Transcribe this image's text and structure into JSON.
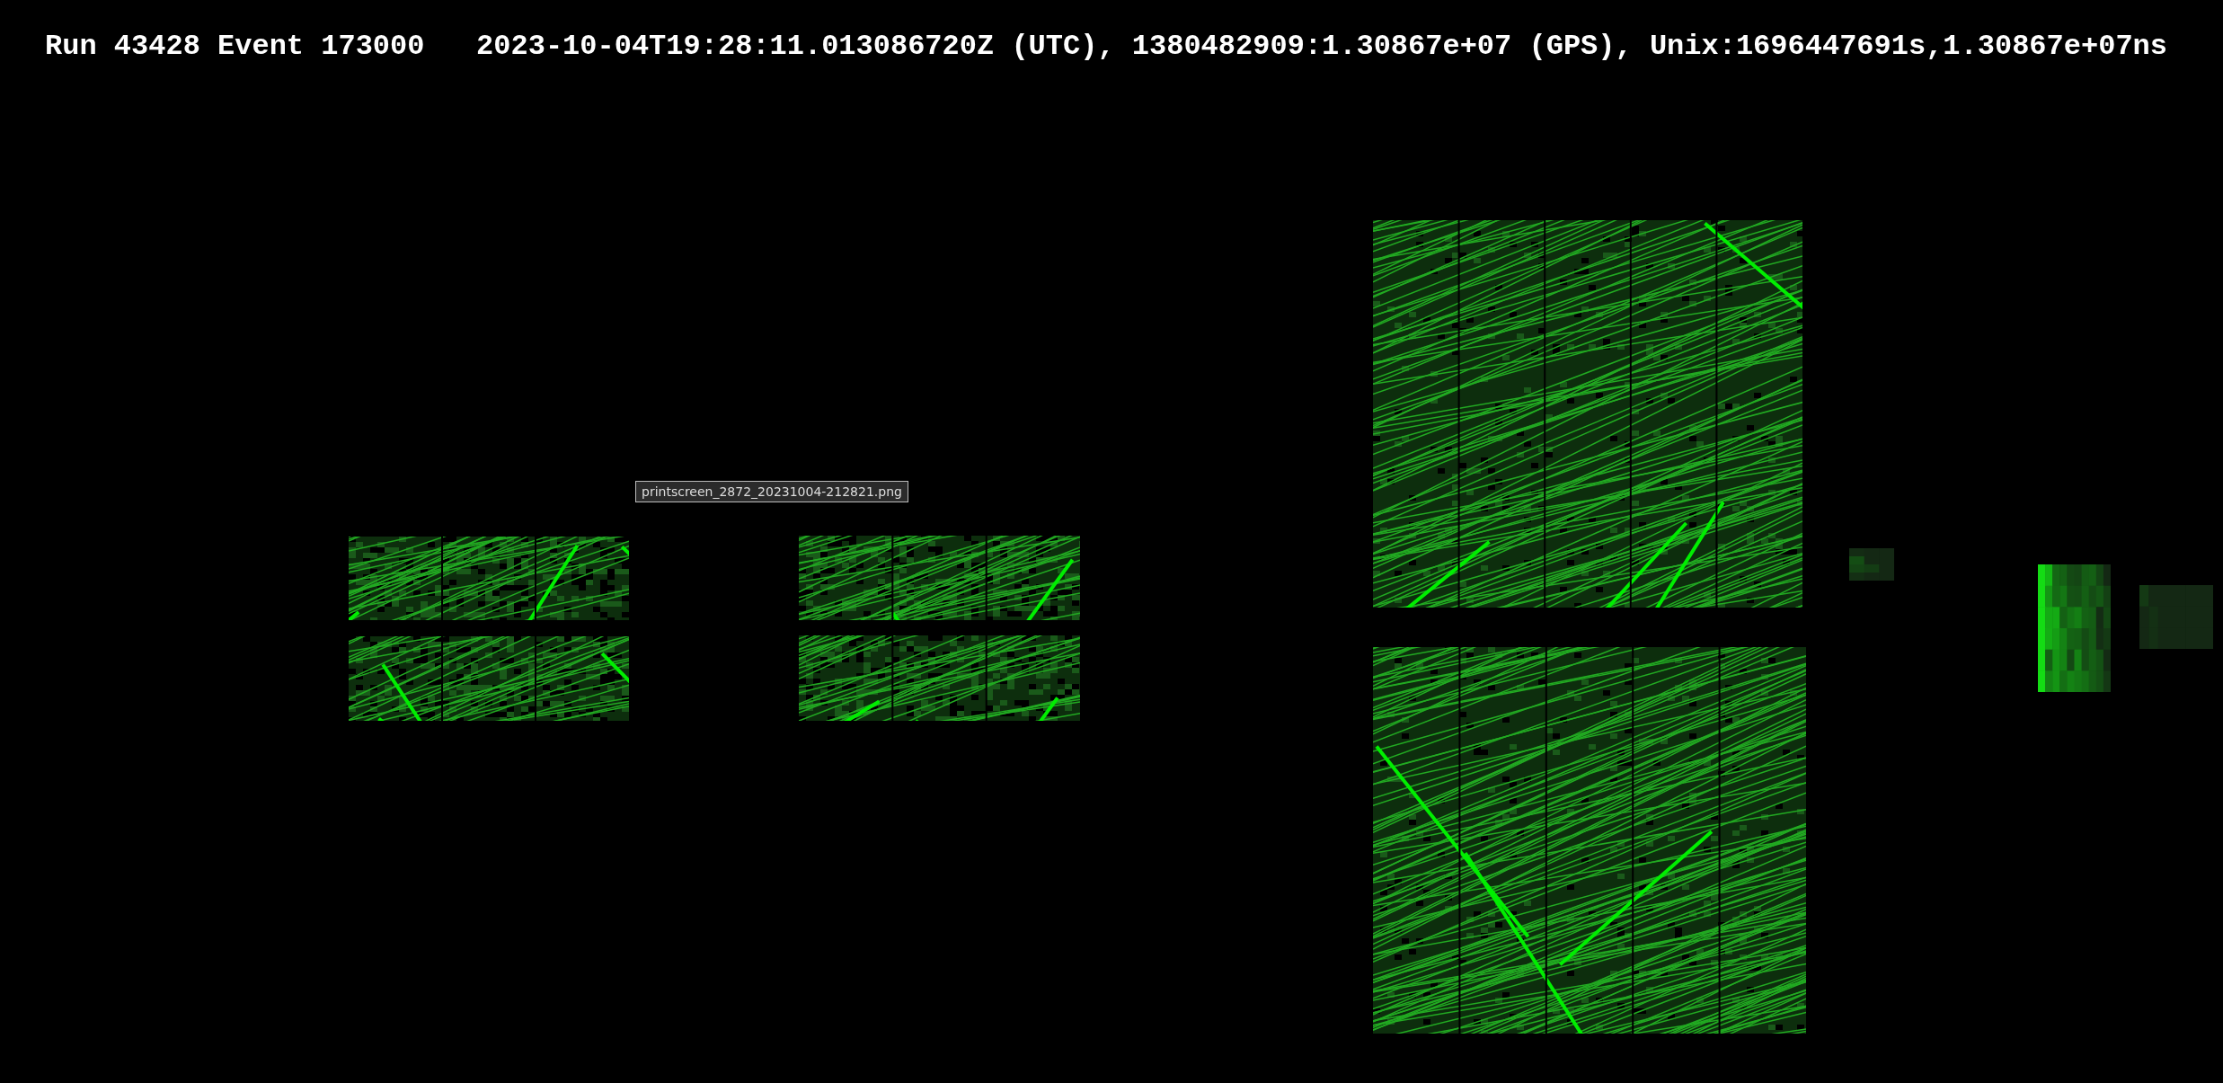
{
  "header": {
    "title": "Run 43428 Event 173000   2023-10-04T19:28:11.013086720Z (UTC), 1380482909:1.30867e+07 (GPS), Unix:1696447691s,1.30867e+07ns"
  },
  "tooltip": {
    "text": "printscreen_2872_20231004-212821.png"
  }
}
